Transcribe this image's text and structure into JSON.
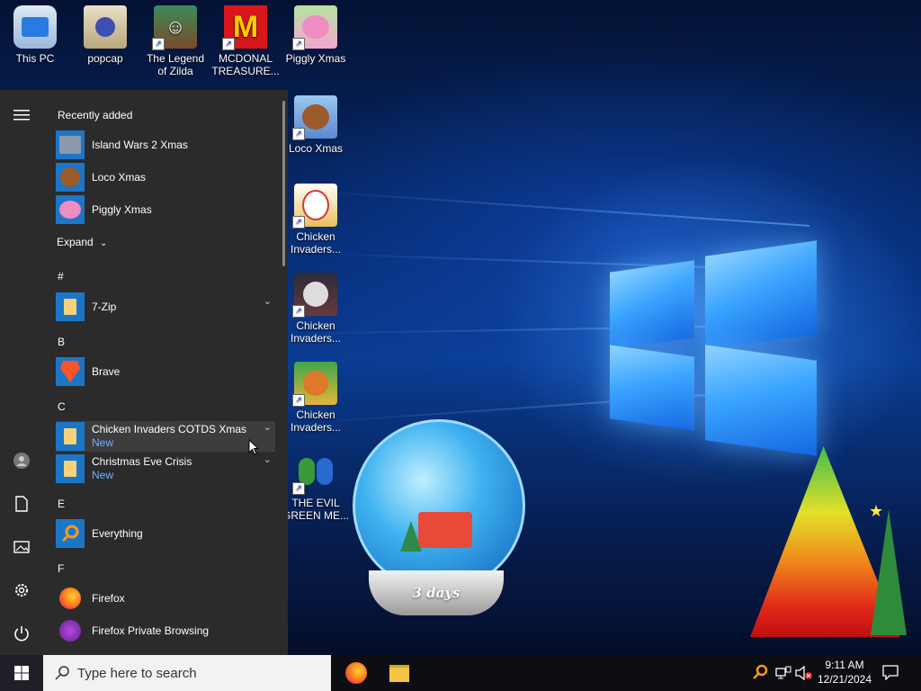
{
  "desktop": {
    "icons": [
      {
        "label": "This PC",
        "icon": "monitor-icon"
      },
      {
        "label": "popcap",
        "icon": "folder-icon"
      },
      {
        "label": "The Legend of Zilda",
        "icon": "game-character-icon"
      },
      {
        "label": "MCDONAL TREASURE...",
        "icon": "mcdonalds-logo-icon"
      },
      {
        "label": "Piggly Xmas",
        "icon": "pig-icon"
      },
      {
        "label": "Loco Xmas",
        "icon": "bear-icon"
      },
      {
        "label": "Chicken Invaders...",
        "icon": "chicken-icon"
      },
      {
        "label": "Chicken Invaders...",
        "icon": "chicken-eggs-icon"
      },
      {
        "label": "Chicken Invaders...",
        "icon": "chicken-green-icon"
      },
      {
        "label": "THE EVIL GREEN ME...",
        "icon": "messenger-people-icon"
      }
    ],
    "snow_globe_label": "3 days"
  },
  "start_menu": {
    "recently_added_heading": "Recently added",
    "recent": [
      {
        "label": "Island Wars 2 Xmas"
      },
      {
        "label": "Loco Xmas"
      },
      {
        "label": "Piggly Xmas"
      }
    ],
    "expand_label": "Expand",
    "sections": {
      "hash": "#",
      "b": "B",
      "c": "C",
      "e": "E",
      "f": "F"
    },
    "apps": {
      "seven_zip": "7-Zip",
      "brave": "Brave",
      "chicken_invaders": "Chicken Invaders COTDS Xmas",
      "chicken_invaders_new": "New",
      "christmas_eve": "Christmas Eve Crisis",
      "christmas_eve_new": "New",
      "everything": "Everything",
      "firefox": "Firefox",
      "firefox_private": "Firefox Private Browsing"
    }
  },
  "taskbar": {
    "search_placeholder": "Type here to search",
    "time": "9:11 AM",
    "date": "12/21/2024"
  }
}
